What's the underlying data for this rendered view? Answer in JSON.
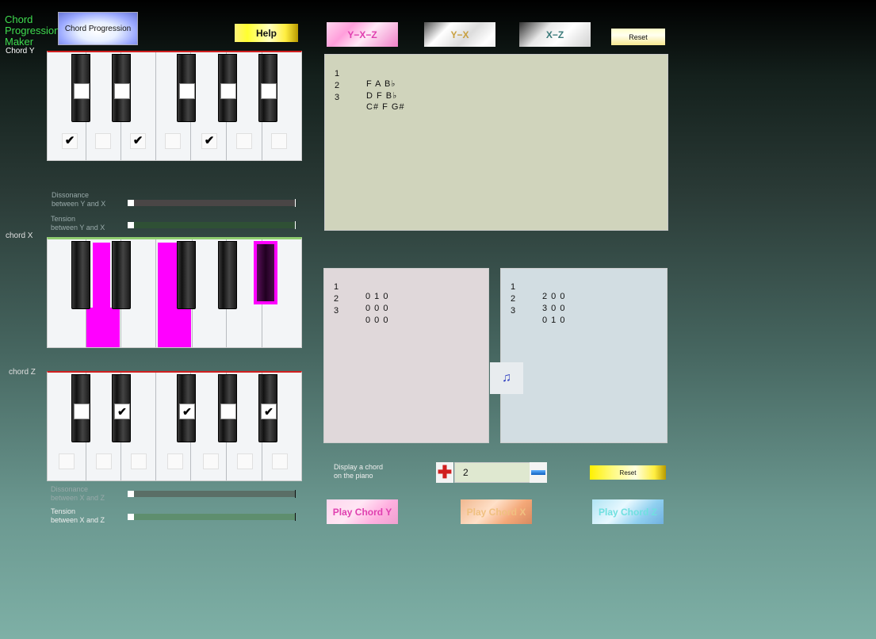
{
  "app": {
    "title_line1": "Chord",
    "title_line2": "Progression",
    "title_line3": "Maker"
  },
  "labels": {
    "chord_y": "Chord Y",
    "chord_x": "chord X",
    "chord_z": "chord Z"
  },
  "buttons": {
    "chord_progression": "Chord Progression",
    "help": "Help",
    "reset_top": "Reset",
    "reset_bottom": "Reset",
    "play_y": "Play Chord Y",
    "play_x": "Play Chord X",
    "play_z": "Play Chord Z"
  },
  "tabs": [
    {
      "label": "Y−X−Z"
    },
    {
      "label": "Y−X"
    },
    {
      "label": "X−Z"
    }
  ],
  "sliders": {
    "dissonance_yx": {
      "line1": "Dissonance",
      "line2": "between Y and X",
      "value": 0
    },
    "tension_yx": {
      "line1": "Tension",
      "line2": "between Y and X",
      "value": 0
    },
    "dissonance_xz": {
      "line1": "Dissonance",
      "line2": "between X and Z",
      "value": 0
    },
    "tension_xz": {
      "line1": "Tension",
      "line2": "between X and Z",
      "value": 0
    }
  },
  "chord_list": [
    {
      "index": "1",
      "notes": "F A B♭"
    },
    {
      "index": "2",
      "notes": "D F B♭"
    },
    {
      "index": "3",
      "notes": "C# F G#"
    }
  ],
  "left_list": [
    {
      "index": "1",
      "value": "0 1 0"
    },
    {
      "index": "2",
      "value": "0 0 0"
    },
    {
      "index": "3",
      "value": "0 0 0"
    }
  ],
  "right_list": [
    {
      "index": "1",
      "value": "2 0 0"
    },
    {
      "index": "2",
      "value": "3 0 0"
    },
    {
      "index": "3",
      "value": "0 1 0"
    }
  ],
  "display": {
    "line1": "Display a chord",
    "line2": "on the piano",
    "value": "2"
  },
  "icons": {
    "plus": "✚",
    "mid": "♫"
  },
  "colors": {
    "highlight": "#ff00ff",
    "accent_green": "#3fdc4f"
  }
}
